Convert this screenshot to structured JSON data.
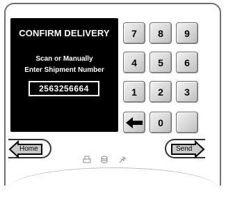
{
  "screen": {
    "title": "CONFIRM DELIVERY",
    "instruction_line1": "Scan or Manually",
    "instruction_line2": "Enter Shipment Number",
    "shipment_number": "2563256664"
  },
  "keypad": {
    "k7": "7",
    "k8": "8",
    "k9": "9",
    "k4": "4",
    "k5": "5",
    "k6": "6",
    "k1": "1",
    "k2": "2",
    "k3": "3",
    "k0": "0",
    "back_icon": "left-arrow-icon"
  },
  "nav": {
    "home_label": "Home",
    "send_label": "Send"
  },
  "status_icons": [
    "printer-icon",
    "database-icon",
    "signal-icon"
  ]
}
